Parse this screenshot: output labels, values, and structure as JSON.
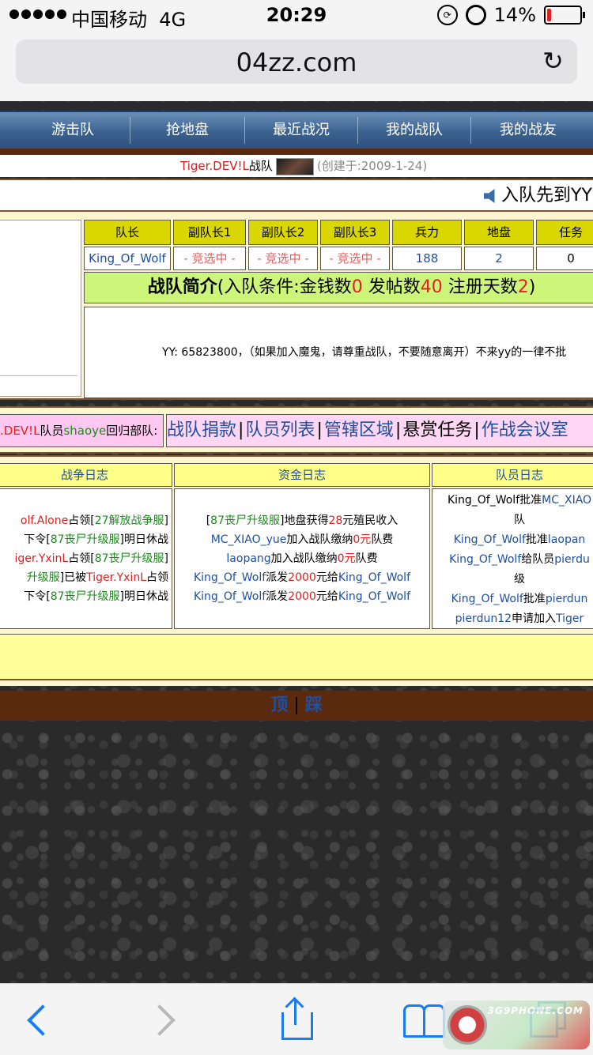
{
  "status_bar": {
    "carrier": "中国移动",
    "network": "4G",
    "time": "20:29",
    "battery": "14%",
    "battery_level": 0.14
  },
  "browser": {
    "url": "04zz.com"
  },
  "nav": {
    "items": [
      "游击队",
      "抢地盘",
      "最近战况",
      "我的战队",
      "我的战友"
    ]
  },
  "team": {
    "name": "Tiger.DEV!L",
    "label": "战队",
    "created": "(创建于:2009-1-24)"
  },
  "marquee": {
    "text": "入队先到YY"
  },
  "roster": {
    "headers": [
      "队长",
      "副队长1",
      "副队长2",
      "副队长3",
      "兵力",
      "地盘",
      "任务"
    ],
    "values": [
      "King_Of_Wolf",
      "- 竞选中 -",
      "- 竞选中 -",
      "- 竞选中 -",
      "188",
      "2",
      "0"
    ]
  },
  "intro": {
    "title": "战队简介",
    "prefix": "(入队条件:金钱数",
    "money": "0",
    "posts_label": " 发帖数",
    "posts": "40",
    "days_label": " 注册天数",
    "days": "2",
    "suffix": ")",
    "body": "YY: 65823800，（如果加入魔鬼，请尊重战队，不要随意离开）不来yy的一律不批"
  },
  "return_notice": {
    "team": ".DEV!L",
    "member_label": "队员",
    "member": "shaoye",
    "action": "回归部队:"
  },
  "func_links": [
    "战队捐款",
    "队员列表",
    "管辖区域",
    "悬赏任务",
    "作战会议室"
  ],
  "logs": {
    "war_title": "战争日志",
    "fund_title": "资金日志",
    "member_title": "队员日志",
    "war_lines": [
      [
        {
          "t": "olf.Alone",
          "c": "red"
        },
        {
          "t": "占领[",
          "c": "dark"
        },
        {
          "t": "27解放战争服",
          "c": "green"
        },
        {
          "t": "]",
          "c": "dark"
        }
      ],
      [
        {
          "t": "下令[",
          "c": "dark"
        },
        {
          "t": "87丧尸升级服",
          "c": "green"
        },
        {
          "t": "]明日休战",
          "c": "dark"
        }
      ],
      [
        {
          "t": "iger.YxinL",
          "c": "red"
        },
        {
          "t": "占领[",
          "c": "dark"
        },
        {
          "t": "87丧尸升级服",
          "c": "green"
        },
        {
          "t": "]",
          "c": "dark"
        }
      ],
      [
        {
          "t": "升级服",
          "c": "green"
        },
        {
          "t": "]已被",
          "c": "dark"
        },
        {
          "t": "Tiger.YxinL",
          "c": "red"
        },
        {
          "t": "占领",
          "c": "dark"
        }
      ],
      [
        {
          "t": "下令[",
          "c": "dark"
        },
        {
          "t": "87丧尸升级服",
          "c": "green"
        },
        {
          "t": "]明日休战",
          "c": "dark"
        }
      ]
    ],
    "fund_lines": [
      [
        {
          "t": "[",
          "c": "dark"
        },
        {
          "t": "87丧尸升级服",
          "c": "green"
        },
        {
          "t": "]地盘获得",
          "c": "dark"
        },
        {
          "t": "28",
          "c": "red"
        },
        {
          "t": "元殖民收入",
          "c": "dark"
        }
      ],
      [
        {
          "t": "MC_XIAO_yue",
          "c": "blue"
        },
        {
          "t": "加入战队缴纳",
          "c": "dark"
        },
        {
          "t": "0元",
          "c": "red"
        },
        {
          "t": "队费",
          "c": "dark"
        }
      ],
      [
        {
          "t": "laopang",
          "c": "blue"
        },
        {
          "t": "加入战队缴纳",
          "c": "dark"
        },
        {
          "t": "0元",
          "c": "red"
        },
        {
          "t": "队费",
          "c": "dark"
        }
      ],
      [
        {
          "t": "King_Of_Wolf",
          "c": "blue"
        },
        {
          "t": "派发",
          "c": "dark"
        },
        {
          "t": "2000",
          "c": "red"
        },
        {
          "t": "元给",
          "c": "dark"
        },
        {
          "t": "King_Of_Wolf",
          "c": "blue"
        }
      ],
      [
        {
          "t": "King_Of_Wolf",
          "c": "blue"
        },
        {
          "t": "派发",
          "c": "dark"
        },
        {
          "t": "2000",
          "c": "red"
        },
        {
          "t": "元给",
          "c": "dark"
        },
        {
          "t": "King_Of_Wolf",
          "c": "blue"
        }
      ]
    ],
    "member_lines": [
      [
        {
          "t": "King_Of_Wolf",
          "c": "dark"
        },
        {
          "t": "批准",
          "c": "dark"
        },
        {
          "t": "MC_XIAO",
          "c": "blue"
        }
      ],
      [
        {
          "t": "队",
          "c": "dark"
        }
      ],
      [
        {
          "t": "King_Of_Wolf",
          "c": "blue"
        },
        {
          "t": "批准",
          "c": "dark"
        },
        {
          "t": "laopan",
          "c": "blue"
        }
      ],
      [
        {
          "t": "King_Of_Wolf",
          "c": "blue"
        },
        {
          "t": "给队员",
          "c": "dark"
        },
        {
          "t": "pierdu",
          "c": "blue"
        }
      ],
      [
        {
          "t": "级",
          "c": "dark"
        }
      ],
      [
        {
          "t": "King_Of_Wolf",
          "c": "blue"
        },
        {
          "t": "批准",
          "c": "dark"
        },
        {
          "t": "pierdun",
          "c": "blue"
        }
      ],
      [
        {
          "t": "pierdun12",
          "c": "blue"
        },
        {
          "t": "申请加入",
          "c": "dark"
        },
        {
          "t": "Tiger",
          "c": "blue"
        }
      ]
    ]
  },
  "pager": {
    "top": "顶",
    "sep": "|",
    "bottom": "踩"
  },
  "watermark": {
    "text": "3G9PHONE.COM"
  },
  "colors": {
    "nav_blue": "#3b628f",
    "brown": "#5b2a0e",
    "header_yellow": "#d9d600",
    "intro_green": "#cdf57a",
    "ios_blue": "#1a7cf2"
  }
}
